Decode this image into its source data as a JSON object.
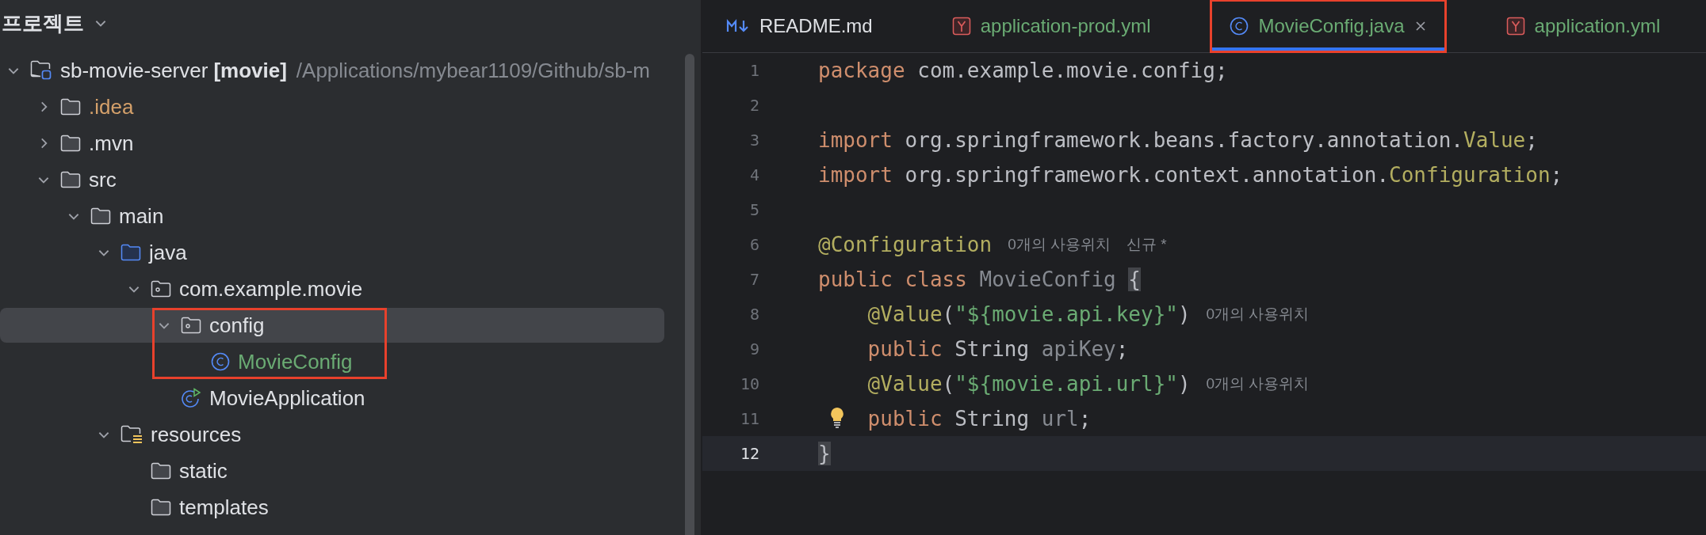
{
  "panel": {
    "title": "프로젝트"
  },
  "tree": [
    {
      "kind": "module",
      "name": "sb-movie-server",
      "module": "[movie]",
      "path": "/Applications/mybear1109/Github/sb-m",
      "color": "#dfe1e5",
      "expanded": true,
      "selected": false,
      "outlined": false,
      "children": [
        {
          "kind": "folder",
          "name": ".idea",
          "color": "#d4a06a",
          "expanded": false,
          "selected": false,
          "outlined": false
        },
        {
          "kind": "folder",
          "name": ".mvn",
          "color": "#dfe1e5",
          "expanded": false,
          "selected": false,
          "outlined": false
        },
        {
          "kind": "folder",
          "name": "src",
          "color": "#dfe1e5",
          "expanded": true,
          "selected": false,
          "outlined": false,
          "children": [
            {
              "kind": "folder",
              "name": "main",
              "color": "#dfe1e5",
              "expanded": true,
              "selected": false,
              "outlined": false,
              "children": [
                {
                  "kind": "source-folder",
                  "name": "java",
                  "color": "#dfe1e5",
                  "expanded": true,
                  "selected": false,
                  "outlined": false,
                  "children": [
                    {
                      "kind": "package",
                      "name": "com.example.movie",
                      "color": "#dfe1e5",
                      "expanded": true,
                      "selected": false,
                      "outlined": false,
                      "children": [
                        {
                          "kind": "package",
                          "name": "config",
                          "color": "#dfe1e5",
                          "expanded": true,
                          "selected": true,
                          "outlined": true,
                          "children": [
                            {
                              "kind": "class",
                              "name": "MovieConfig",
                              "color": "#6aab73",
                              "selected": false,
                              "outlined": false
                            }
                          ]
                        },
                        {
                          "kind": "main-class",
                          "name": "MovieApplication",
                          "color": "#dfe1e5",
                          "selected": false,
                          "outlined": false
                        }
                      ]
                    }
                  ]
                },
                {
                  "kind": "resources-folder",
                  "name": "resources",
                  "color": "#dfe1e5",
                  "expanded": true,
                  "selected": false,
                  "outlined": false,
                  "children": [
                    {
                      "kind": "folder",
                      "name": "static",
                      "color": "#dfe1e5",
                      "selected": false,
                      "outlined": false
                    },
                    {
                      "kind": "folder",
                      "name": "templates",
                      "color": "#dfe1e5",
                      "selected": false,
                      "outlined": false
                    }
                  ]
                }
              ]
            }
          ]
        }
      ]
    }
  ],
  "tabs": [
    {
      "kind": "markdown",
      "label": "README.md",
      "color": "#dfe1e5",
      "selected": false,
      "outlined": false
    },
    {
      "kind": "yaml",
      "label": "application-prod.yml",
      "color": "#6aab73",
      "selected": false,
      "outlined": false
    },
    {
      "kind": "class",
      "label": "MovieConfig.java",
      "color": "#6aab73",
      "selected": true,
      "outlined": true
    },
    {
      "kind": "yaml",
      "label": "application.yml",
      "color": "#6aab73",
      "selected": false,
      "outlined": false
    }
  ],
  "code": [
    {
      "number": "1",
      "current": false,
      "bulb": false,
      "tokens": [
        {
          "kind": "keyword",
          "text": "package "
        },
        {
          "kind": "plain",
          "text": "com.example.movie.config;"
        }
      ]
    },
    {
      "number": "2",
      "current": false,
      "bulb": false
    },
    {
      "number": "3",
      "current": false,
      "bulb": false,
      "tokens": [
        {
          "kind": "keyword",
          "text": "import "
        },
        {
          "kind": "plain",
          "text": "org.springframework.beans.factory.annotation."
        },
        {
          "kind": "annotation",
          "text": "Value"
        },
        {
          "kind": "plain",
          "text": ";"
        }
      ]
    },
    {
      "number": "4",
      "current": false,
      "bulb": false,
      "tokens": [
        {
          "kind": "keyword",
          "text": "import "
        },
        {
          "kind": "plain",
          "text": "org.springframework.context.annotation."
        },
        {
          "kind": "annotation",
          "text": "Configuration"
        },
        {
          "kind": "plain",
          "text": ";"
        }
      ]
    },
    {
      "number": "5",
      "current": false,
      "bulb": false
    },
    {
      "number": "6",
      "current": false,
      "bulb": false,
      "tokens": [
        {
          "kind": "annotation",
          "text": "@Configuration"
        },
        {
          "kind": "hint",
          "text": "0개의 사용위치"
        },
        {
          "kind": "hint",
          "text": "신규 *"
        }
      ]
    },
    {
      "number": "7",
      "current": false,
      "bulb": false,
      "tokens": [
        {
          "kind": "keyword",
          "text": "public class "
        },
        {
          "kind": "unused",
          "text": "MovieConfig "
        },
        {
          "kind": "brace",
          "text": "{"
        }
      ]
    },
    {
      "number": "8",
      "current": false,
      "bulb": false,
      "tokens": [
        {
          "kind": "annotation",
          "text": "    @Value"
        },
        {
          "kind": "plain",
          "text": "("
        },
        {
          "kind": "string",
          "text": "\"${movie.api.key}\""
        },
        {
          "kind": "plain",
          "text": ")"
        },
        {
          "kind": "hint",
          "text": "0개의 사용위치"
        }
      ]
    },
    {
      "number": "9",
      "current": false,
      "bulb": false,
      "tokens": [
        {
          "kind": "keyword",
          "text": "    public "
        },
        {
          "kind": "plain",
          "text": "String "
        },
        {
          "kind": "unused",
          "text": "apiKey"
        },
        {
          "kind": "plain",
          "text": ";"
        }
      ]
    },
    {
      "number": "10",
      "current": false,
      "bulb": false,
      "tokens": [
        {
          "kind": "annotation",
          "text": "    @Value"
        },
        {
          "kind": "plain",
          "text": "("
        },
        {
          "kind": "string",
          "text": "\"${movie.api.url}\""
        },
        {
          "kind": "plain",
          "text": ")"
        },
        {
          "kind": "hint",
          "text": "0개의 사용위치"
        }
      ]
    },
    {
      "number": "11",
      "current": false,
      "bulb": true,
      "tokens": [
        {
          "kind": "keyword",
          "text": "    public "
        },
        {
          "kind": "plain",
          "text": "String "
        },
        {
          "kind": "unused",
          "text": "url"
        },
        {
          "kind": "plain",
          "text": ";"
        }
      ]
    },
    {
      "number": "12",
      "current": true,
      "bulb": false,
      "tokens": [
        {
          "kind": "brace",
          "text": "}"
        }
      ]
    }
  ]
}
